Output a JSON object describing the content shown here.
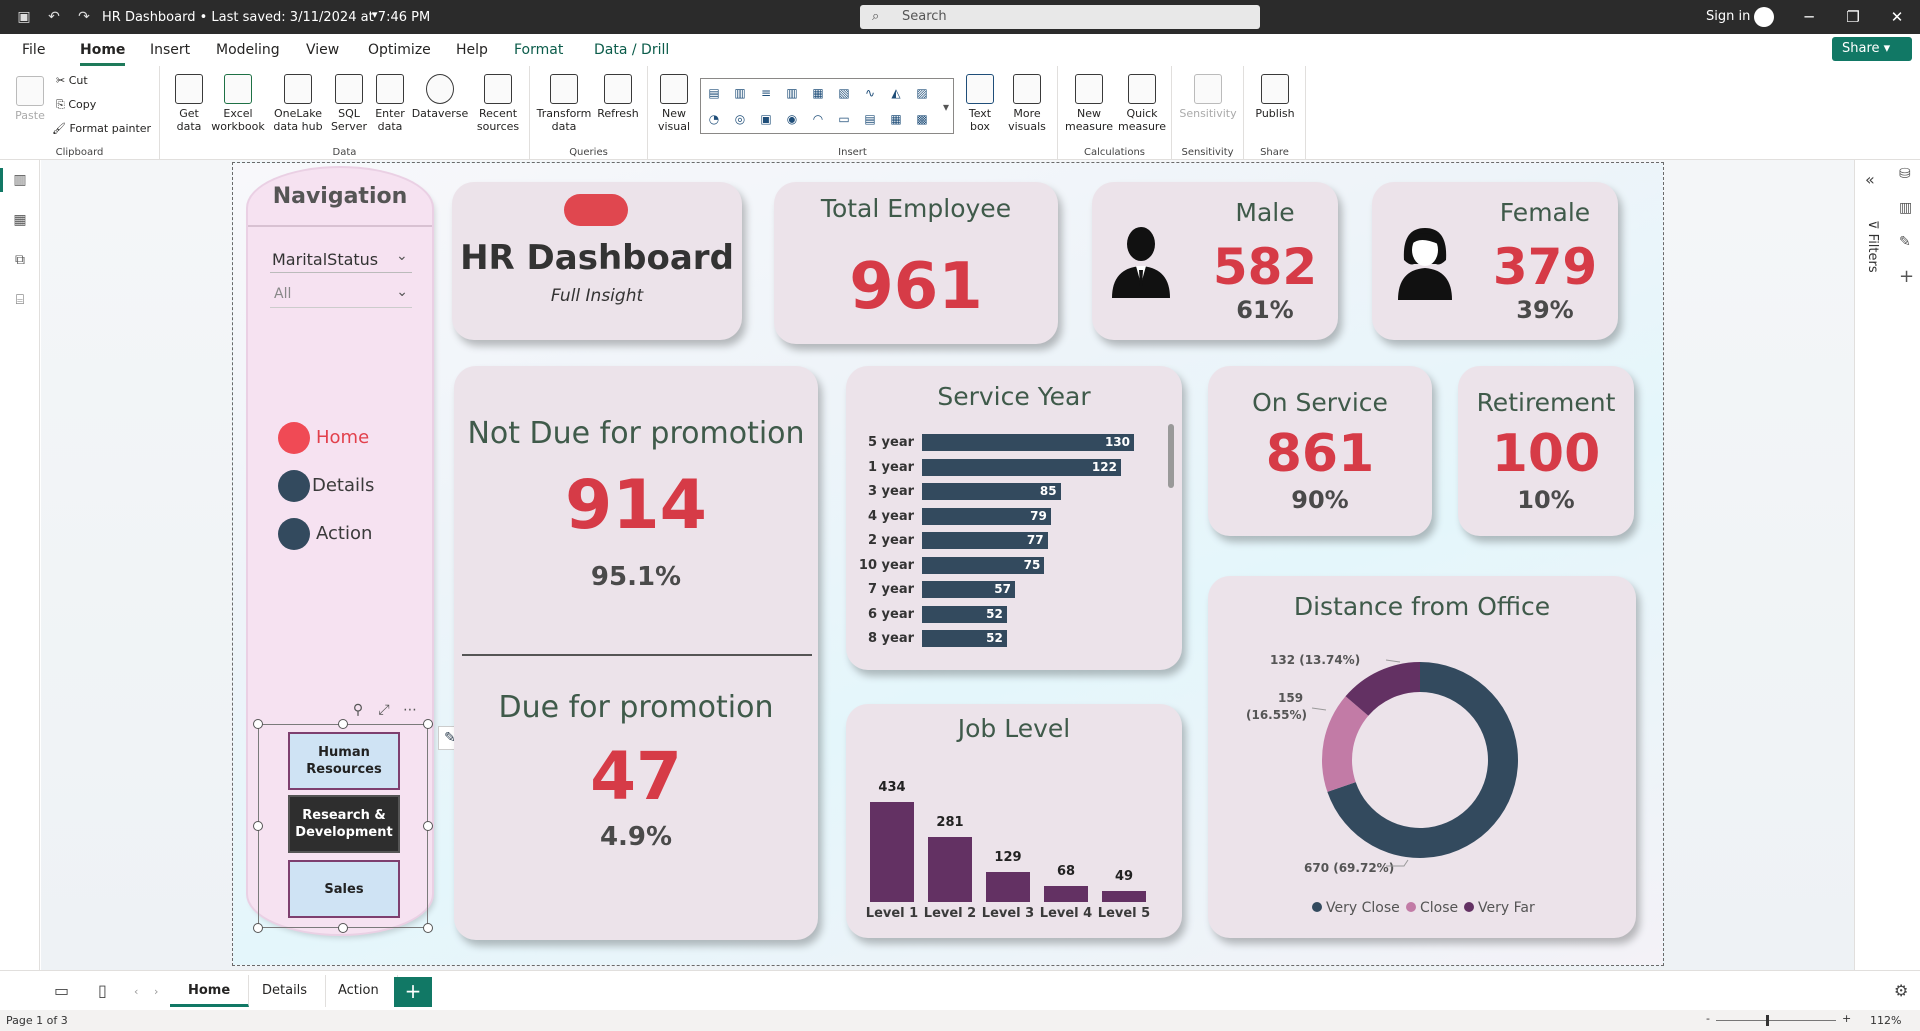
{
  "titlebar": {
    "title": "HR Dashboard • Last saved: 3/11/2024 at 7:46 PM",
    "search_placeholder": "Search",
    "signin": "Sign in"
  },
  "ribbon_tabs": [
    "File",
    "Home",
    "Insert",
    "Modeling",
    "View",
    "Optimize",
    "Help",
    "Format",
    "Data / Drill"
  ],
  "share_label": "Share",
  "ribbon": {
    "clipboard": {
      "paste": "Paste",
      "cut": "Cut",
      "copy": "Copy",
      "format_painter": "Format painter",
      "label": "Clipboard"
    },
    "data": {
      "get_data": "Get data",
      "excel": "Excel workbook",
      "onelake": "OneLake data hub",
      "sql": "SQL Server",
      "enter": "Enter data",
      "dataverse": "Dataverse",
      "recent": "Recent sources",
      "label": "Data"
    },
    "queries": {
      "transform": "Transform data",
      "refresh": "Refresh",
      "label": "Queries"
    },
    "insert": {
      "new_visual": "New visual",
      "text_box": "Text box",
      "more_visuals": "More visuals",
      "label": "Insert"
    },
    "calculations": {
      "new_measure": "New measure",
      "quick_measure": "Quick measure",
      "label": "Calculations"
    },
    "sensitivity": {
      "btn": "Sensitivity",
      "label": "Sensitivity"
    },
    "share": {
      "publish": "Publish",
      "label": "Share"
    }
  },
  "right_panel": {
    "filters": "Filters"
  },
  "navigation": {
    "title": "Navigation",
    "slicer_title": "MaritalStatus",
    "slicer_value": "All",
    "buttons": [
      {
        "label": "Home",
        "active": true
      },
      {
        "label": "Details",
        "active": false
      },
      {
        "label": "Action",
        "active": false
      }
    ],
    "departments": [
      {
        "label": "Human Resources",
        "selected": false
      },
      {
        "label": "Research & Development",
        "selected": true
      },
      {
        "label": "Sales",
        "selected": false
      }
    ]
  },
  "header_card": {
    "title": "HR Dashboard",
    "subtitle": "Full Insight"
  },
  "total_employee": {
    "title": "Total Employee",
    "value": "961"
  },
  "male": {
    "title": "Male",
    "value": "582",
    "pct": "61%"
  },
  "female": {
    "title": "Female",
    "value": "379",
    "pct": "39%"
  },
  "not_due": {
    "title": "Not Due for promotion",
    "value": "914",
    "pct": "95.1%"
  },
  "due": {
    "title": "Due for promotion",
    "value": "47",
    "pct": "4.9%"
  },
  "on_service": {
    "title": "On Service",
    "value": "861",
    "pct": "90%"
  },
  "retirement": {
    "title": "Retirement",
    "value": "100",
    "pct": "10%"
  },
  "colors": {
    "accent_red": "#d63b47",
    "navy": "#334a5e",
    "purple": "#633163",
    "pink": "#c27ba6",
    "nav_bg": "#f6e2f1"
  },
  "chart_data": [
    {
      "type": "bar",
      "orientation": "horizontal",
      "title": "Service Year",
      "categories": [
        "5 year",
        "1 year",
        "3 year",
        "4 year",
        "2 year",
        "10 year",
        "7 year",
        "6 year",
        "8 year"
      ],
      "values": [
        130,
        122,
        85,
        79,
        77,
        75,
        57,
        52,
        52
      ]
    },
    {
      "type": "bar",
      "title": "Job Level",
      "categories": [
        "Level 1",
        "Level 2",
        "Level 3",
        "Level 4",
        "Level 5"
      ],
      "values": [
        434,
        281,
        129,
        68,
        49
      ]
    },
    {
      "type": "pie",
      "donut": true,
      "title": "Distance from Office",
      "slices": [
        {
          "name": "Very Close",
          "value": 670,
          "label": "670 (69.72%)",
          "color": "#334a5e"
        },
        {
          "name": "Close",
          "value": 159,
          "label": "159 (16.55%)",
          "color": "#c27ba6"
        },
        {
          "name": "Very Far",
          "value": 132,
          "label": "132 (13.74%)",
          "color": "#633163"
        }
      ],
      "legend": "bottom"
    }
  ],
  "page_tabs": [
    "Home",
    "Details",
    "Action"
  ],
  "status": {
    "page": "Page 1 of 3",
    "zoom": "112%"
  }
}
